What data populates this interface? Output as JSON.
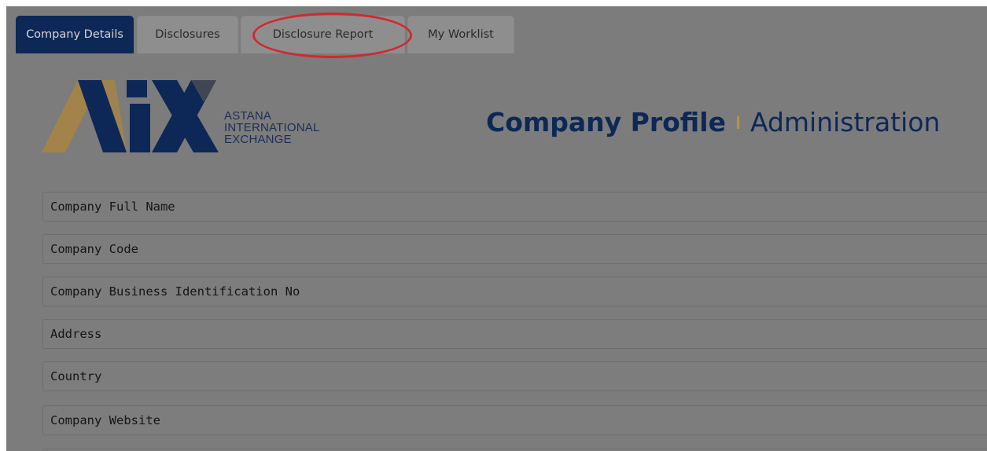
{
  "tabs": [
    {
      "label": "Company Details",
      "active": true
    },
    {
      "label": "Disclosures",
      "active": false
    },
    {
      "label": "Disclosure Report",
      "active": false
    },
    {
      "label": "My Worklist",
      "active": false
    }
  ],
  "logo": {
    "line1": "ASTANA",
    "line2": "INTERNATIONAL",
    "line3": "EXCHANGE",
    "colors": {
      "gold": "#a3834a",
      "navy": "#0d2756"
    }
  },
  "heading": {
    "strong": "Company Profile",
    "light": "Administration"
  },
  "fields": [
    {
      "placeholder": "Company Full Name"
    },
    {
      "placeholder": "Company Code"
    },
    {
      "placeholder": "Company Business Identification No"
    },
    {
      "placeholder": "Address"
    },
    {
      "placeholder": "Country"
    },
    {
      "placeholder": "Company Website"
    }
  ],
  "colors": {
    "accent": "#0d2756",
    "annotation": "#d2282e",
    "separator": "#b4934a"
  }
}
